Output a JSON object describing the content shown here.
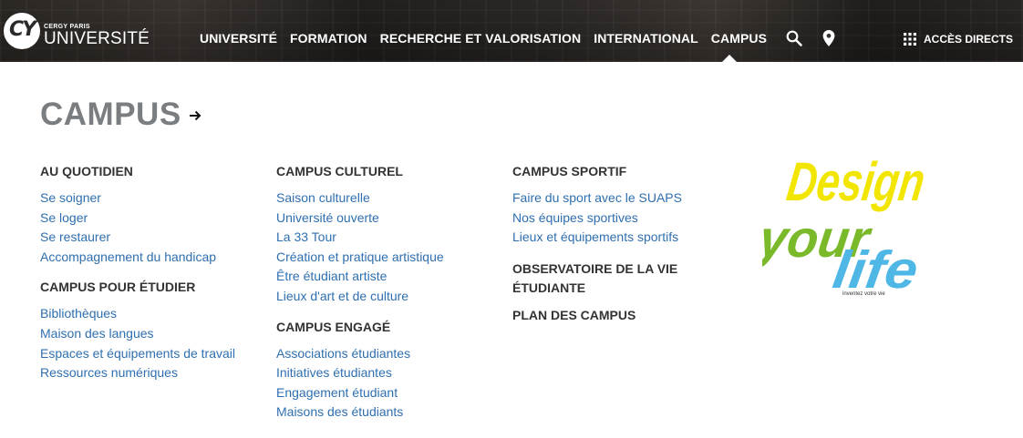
{
  "header": {
    "logo": {
      "mark": "CY",
      "small": "CERGY PARIS",
      "main": "UNIVERSITÉ"
    },
    "nav": [
      {
        "label": "UNIVERSITÉ"
      },
      {
        "label": "FORMATION"
      },
      {
        "label": "RECHERCHE ET VALORISATION"
      },
      {
        "label": "INTERNATIONAL"
      },
      {
        "label": "CAMPUS"
      }
    ],
    "active_nav": "CAMPUS",
    "icons": [
      "search-icon",
      "map-pin-icon",
      "apps-grid-icon"
    ],
    "acces_directs": "ACCÈS DIRECTS"
  },
  "menu": {
    "title": "CAMPUS",
    "arrow_icon": "arrow-right-icon",
    "columns": [
      {
        "groups": [
          {
            "heading": "AU QUOTIDIEN",
            "links": [
              "Se soigner",
              "Se loger",
              "Se restaurer",
              "Accompagnement du handicap"
            ]
          },
          {
            "heading": "CAMPUS POUR ÉTUDIER",
            "links": [
              "Bibliothèques",
              "Maison des langues",
              "Espaces et équipements de travail",
              "Ressources numériques"
            ]
          }
        ]
      },
      {
        "groups": [
          {
            "heading": "CAMPUS CULTUREL",
            "links": [
              "Saison culturelle",
              "Université ouverte",
              "La 33 Tour",
              "Création et pratique artistique",
              "Être étudiant artiste",
              "Lieux d'art et de culture"
            ]
          },
          {
            "heading": "CAMPUS ENGAGÉ",
            "links": [
              "Associations étudiantes",
              "Initiatives étudiantes",
              "Engagement étudiant",
              "Maisons des étudiants"
            ]
          }
        ]
      },
      {
        "groups": [
          {
            "heading": "CAMPUS SPORTIF",
            "links": [
              "Faire du sport avec le SUAPS",
              "Nos équipes sportives",
              "Lieux et équipements sportifs"
            ]
          },
          {
            "heading": "OBSERVATOIRE DE LA VIE ÉTUDIANTE",
            "links": []
          },
          {
            "heading": "PLAN DES CAMPUS",
            "links": []
          }
        ]
      }
    ],
    "promo": {
      "word1": "Design",
      "word2": "your",
      "word3": "life",
      "tagline": "inventez votre vie",
      "colors": {
        "design": "#f2e600",
        "your": "#7ab929",
        "life": "#4fb7e6"
      }
    }
  },
  "colors": {
    "link": "#2f6fb0",
    "heading": "#333333",
    "title": "#7b7e80"
  }
}
